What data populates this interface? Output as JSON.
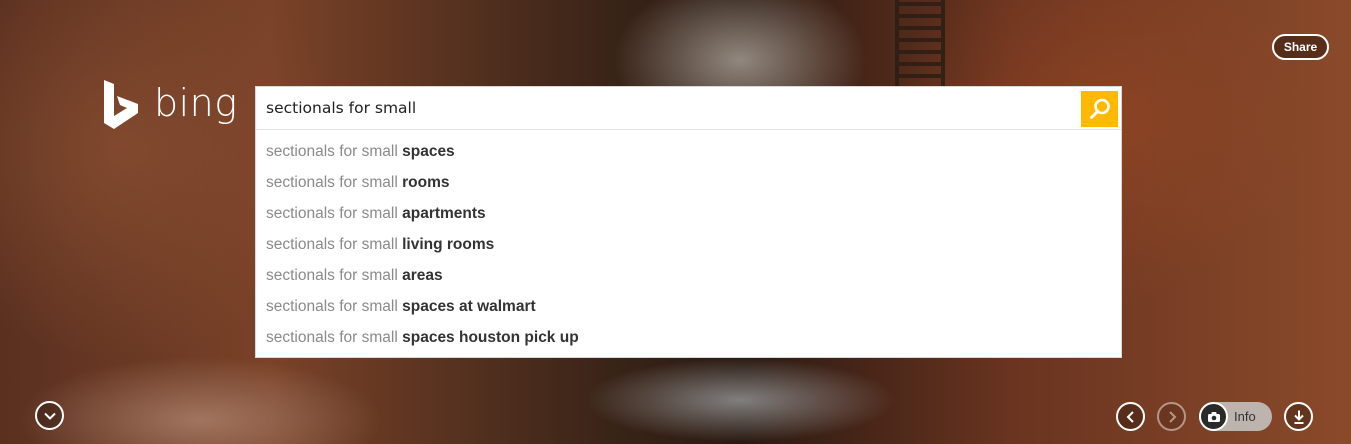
{
  "logo": {
    "text": "bing",
    "icon": "bing-b-logo-icon"
  },
  "header": {
    "share_label": "Share"
  },
  "search": {
    "query": "sectionals for small",
    "button_icon": "search-icon",
    "accent_color": "#ffb900"
  },
  "suggestions": [
    {
      "prefix": "sectionals for small ",
      "suffix": "spaces"
    },
    {
      "prefix": "sectionals for small ",
      "suffix": "rooms"
    },
    {
      "prefix": "sectionals for small ",
      "suffix": "apartments"
    },
    {
      "prefix": "sectionals for small ",
      "suffix": "living rooms"
    },
    {
      "prefix": "sectionals for small ",
      "suffix": "areas"
    },
    {
      "prefix": "sectionals for small ",
      "suffix": "spaces at walmart"
    },
    {
      "prefix": "sectionals for small ",
      "suffix": "spaces houston pick up"
    }
  ],
  "footer": {
    "scroll_down_icon": "chevron-down-icon",
    "prev_icon": "chevron-left-icon",
    "next_icon": "chevron-right-icon",
    "info_icon": "camera-icon",
    "info_label": "Info",
    "download_icon": "download-icon"
  }
}
